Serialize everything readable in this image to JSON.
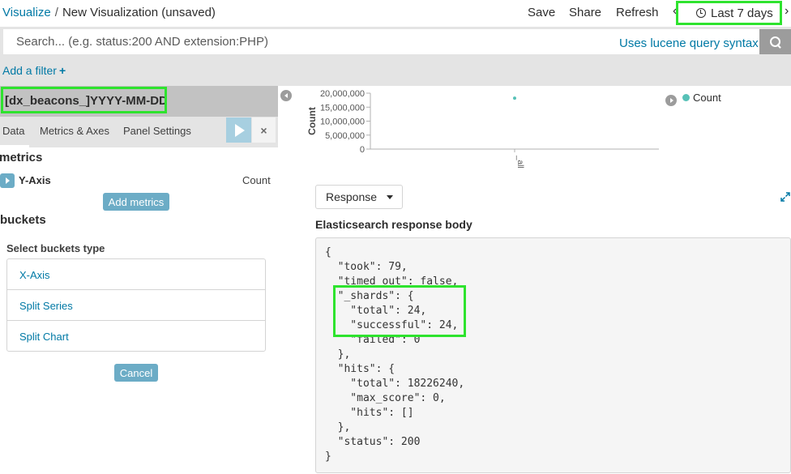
{
  "nav": {
    "breadcrumb_root": "Visualize",
    "breadcrumb_sep": "/",
    "breadcrumb_current": "New Visualization (unsaved)",
    "save": "Save",
    "share": "Share",
    "refresh": "Refresh",
    "time_range": "Last 7 days",
    "chev_left": "‹",
    "chev_right": "›"
  },
  "query": {
    "placeholder": "Search... (e.g. status:200 AND extension:PHP)",
    "lucene_link": "Uses lucene query syntax"
  },
  "filter": {
    "add_filter": "Add a filter",
    "plus": "+"
  },
  "sidebar": {
    "index_pattern": "[dx_beacons_]YYYY-MM-DD",
    "tabs": {
      "data": "Data",
      "metrics_axes": "Metrics & Axes",
      "panel_settings": "Panel Settings"
    },
    "discard": "×",
    "metrics_heading": "metrics",
    "y_axis_label": "Y-Axis",
    "y_axis_agg": "Count",
    "add_metrics": "Add metrics",
    "buckets_heading": "buckets",
    "select_buckets_label": "Select buckets type",
    "bucket_types": [
      "X-Axis",
      "Split Series",
      "Split Chart"
    ],
    "cancel": "Cancel"
  },
  "chart_data": {
    "type": "scatter",
    "title": "",
    "xlabel": "",
    "ylabel": "Count",
    "categories": [
      "_all"
    ],
    "series": [
      {
        "name": "Count",
        "values": [
          18226240
        ]
      }
    ],
    "y_ticks": [
      "20,000,000",
      "15,000,000",
      "10,000,000",
      "5,000,000",
      "0"
    ],
    "y_tick_values": [
      20000000,
      15000000,
      10000000,
      5000000,
      0
    ],
    "ylim": [
      0,
      20000000
    ],
    "grid": false,
    "legend": "top-right",
    "colors": {
      "Count": "#57c1b7"
    }
  },
  "response": {
    "select_value": "Response",
    "heading": "Elasticsearch response body",
    "body": "{\n  \"took\": 79,\n  \"timed_out\": false,\n  \"_shards\": {\n    \"total\": 24,\n    \"successful\": 24,\n    \"failed\": 0\n  },\n  \"hits\": {\n    \"total\": 18226240,\n    \"max_score\": 0,\n    \"hits\": []\n  },\n  \"status\": 200\n}"
  },
  "colors": {
    "accent": "#0079a5",
    "button": "#6cacc6",
    "highlight": "#2ee32e",
    "series": "#57c1b7"
  }
}
